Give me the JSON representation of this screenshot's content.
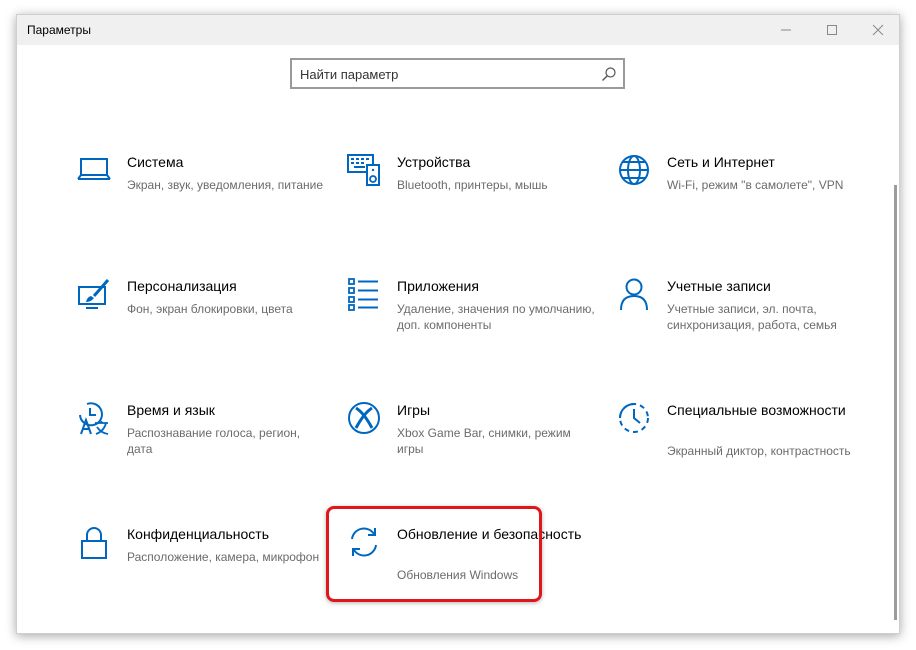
{
  "window": {
    "title": "Параметры"
  },
  "search": {
    "placeholder": "Найти параметр"
  },
  "tiles": [
    {
      "title": "Система",
      "desc": "Экран, звук, уведомления, питание"
    },
    {
      "title": "Устройства",
      "desc": "Bluetooth, принтеры, мышь"
    },
    {
      "title": "Сеть и Интернет",
      "desc": "Wi-Fi, режим \"в самолете\", VPN"
    },
    {
      "title": "Персонализация",
      "desc": "Фон, экран блокировки, цвета"
    },
    {
      "title": "Приложения",
      "desc": "Удаление, значения по умолчанию, доп. компоненты"
    },
    {
      "title": "Учетные записи",
      "desc": "Учетные записи, эл. почта, синхронизация, работа, семья"
    },
    {
      "title": "Время и язык",
      "desc": "Распознавание голоса, регион, дата"
    },
    {
      "title": "Игры",
      "desc": "Xbox Game Bar, снимки, режим игры"
    },
    {
      "title": "Специальные возможности",
      "desc": "Экранный диктор, контрастность"
    },
    {
      "title": "Конфиденциальность",
      "desc": "Расположение, камера, микрофон"
    },
    {
      "title": "Обновление и безопасность",
      "desc": "Обновления Windows"
    }
  ],
  "colors": {
    "accent": "#0067c0",
    "highlight": "#e0161c",
    "titlebar": "#f0f0f0"
  },
  "icons": [
    "laptop-icon",
    "keyboard-speaker-icon",
    "globe-icon",
    "paintbrush-screen-icon",
    "apps-list-icon",
    "person-icon",
    "clock-language-icon",
    "xbox-icon",
    "ease-of-access-icon",
    "lock-icon",
    "sync-icon"
  ]
}
